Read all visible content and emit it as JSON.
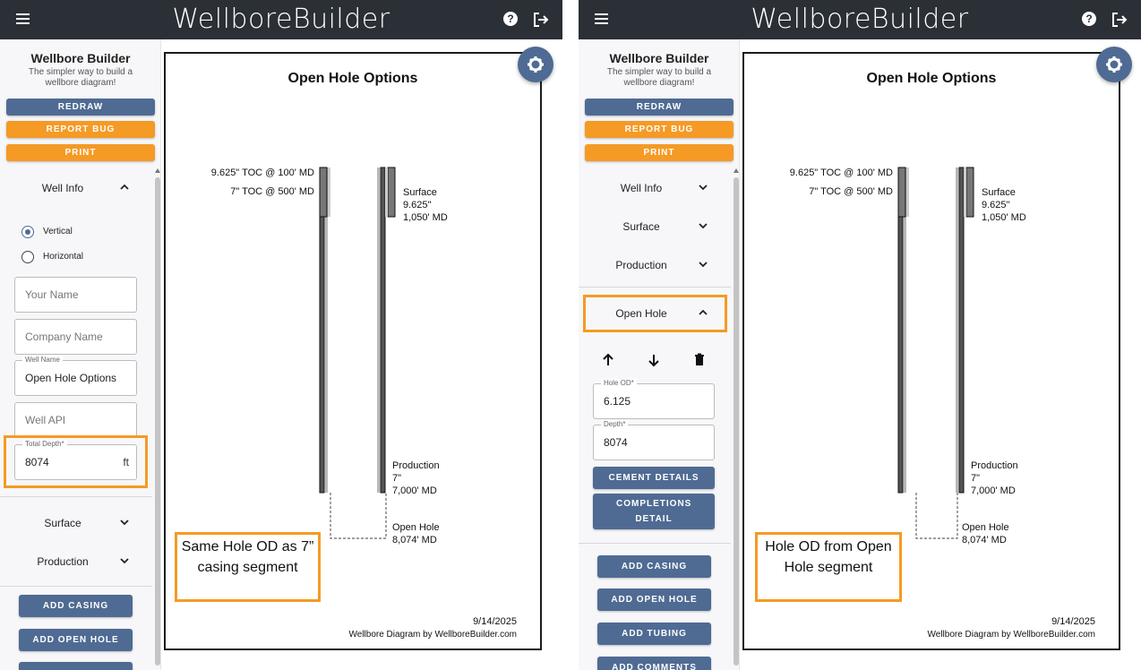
{
  "app": {
    "brand": "WellboreBuilder",
    "brand_color": "#2b2f36",
    "accent_blue": "#4f6b93",
    "accent_orange": "#f59a25"
  },
  "sidebar": {
    "title": "Wellbore Builder",
    "subtitle": "The simpler way to build a wellbore diagram!",
    "buttons": {
      "redraw": "REDRAW",
      "report_bug": "REPORT BUG",
      "print": "PRINT"
    }
  },
  "left": {
    "well_info": {
      "label": "Well Info",
      "radio_vertical": "Vertical",
      "radio_horizontal": "Horizontal",
      "selected": "Vertical",
      "your_name_placeholder": "Your Name",
      "company_name_placeholder": "Company Name",
      "well_name_label": "Well Name",
      "well_name_value": "Open Hole Options",
      "well_api_placeholder": "Well API",
      "total_depth_label": "Total Depth*",
      "total_depth_value": "8074",
      "total_depth_unit": "ft"
    },
    "sections": [
      "Surface",
      "Production"
    ],
    "actions": {
      "add_casing": "ADD CASING",
      "add_open_hole": "ADD OPEN HOLE"
    },
    "note": "Same Hole OD as 7” casing segment"
  },
  "right": {
    "sections": [
      "Well Info",
      "Surface",
      "Production"
    ],
    "open_hole": {
      "label": "Open Hole",
      "hole_od_label": "Hole OD*",
      "hole_od_value": "6.125",
      "depth_label": "Depth*",
      "depth_value": "8074",
      "cement_details": "CEMENT DETAILS",
      "completions_detail": "COMPLETIONS DETAIL"
    },
    "actions": {
      "add_casing": "ADD CASING",
      "add_open_hole": "ADD OPEN HOLE",
      "add_tubing": "ADD TUBING",
      "add_comments": "ADD COMMENTS"
    },
    "note": "Hole OD from Open Hole segment"
  },
  "diagram": {
    "title": "Open Hole Options",
    "toc_surface": "9.625\" TOC @ 100' MD",
    "toc_production": "7\" TOC @ 500' MD",
    "surface_label": "Surface",
    "surface_size": "9.625\"",
    "surface_depth": "1,050' MD",
    "production_label": "Production",
    "production_size": "7\"",
    "production_depth": "7,000' MD",
    "open_hole_label": "Open Hole",
    "open_hole_depth": "8,074' MD",
    "date": "9/14/2025",
    "credit": "Wellbore Diagram by WellboreBuilder.com"
  }
}
